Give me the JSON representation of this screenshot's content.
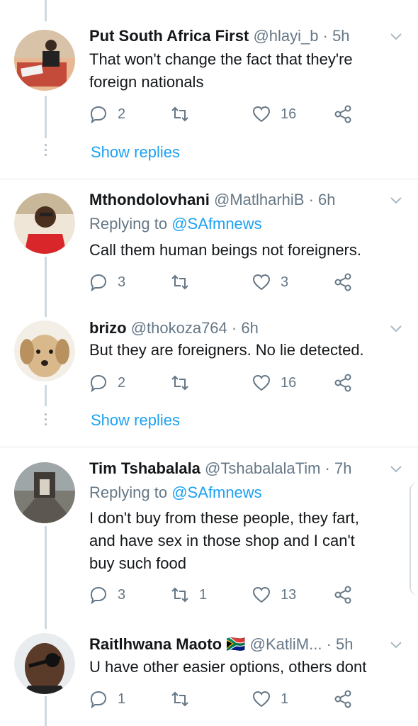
{
  "tweets": [
    {
      "name": "Put South Africa First",
      "handle": "@hlayi_b",
      "time": "· 5h",
      "replying_label": "",
      "replying_to": "",
      "text_lines": [
        "That won't change the fact that they're",
        "foreign nationals"
      ],
      "replies": "2",
      "retweets": "",
      "likes": "16",
      "show_replies": "Show replies"
    },
    {
      "name": "Mthondolovhani",
      "handle": "@MatlharhiB",
      "time": "· 6h",
      "replying_label": "Replying to",
      "replying_to": "@SAfmnews",
      "text_lines": [
        "Call them human beings not foreigners."
      ],
      "replies": "3",
      "retweets": "",
      "likes": "3",
      "show_replies": ""
    },
    {
      "name": "brizo",
      "handle": "@thokoza764",
      "time": "· 6h",
      "replying_label": "",
      "replying_to": "",
      "text_lines": [
        "But they are foreigners. No lie detected."
      ],
      "replies": "2",
      "retweets": "",
      "likes": "16",
      "show_replies": "Show replies"
    },
    {
      "name": "Tim Tshabalala",
      "handle": "@TshabalalaTim",
      "time": "· 7h",
      "replying_label": "Replying to",
      "replying_to": "@SAfmnews",
      "text_lines": [
        "I don't buy from these people, they fart,",
        "and have sex in those shop and I can't",
        "buy such food"
      ],
      "replies": "3",
      "retweets": "1",
      "likes": "13",
      "show_replies": ""
    },
    {
      "name": "Raitlhwana Maoto",
      "flag": "🇿🇦",
      "handle": "@KatliM...",
      "time": "· 5h",
      "replying_label": "",
      "replying_to": "",
      "text_lines": [
        "U have other easier options, others dont"
      ],
      "replies": "1",
      "retweets": "",
      "likes": "1",
      "show_replies": ""
    }
  ],
  "icons": {
    "reply": "reply-icon",
    "retweet": "retweet-icon",
    "like": "heart-icon",
    "share": "share-icon",
    "menu": "chevron-down-icon"
  },
  "colors": {
    "accent": "#1da1f2",
    "muted": "#657786",
    "text": "#14171a",
    "divider": "#e1e8ed"
  }
}
